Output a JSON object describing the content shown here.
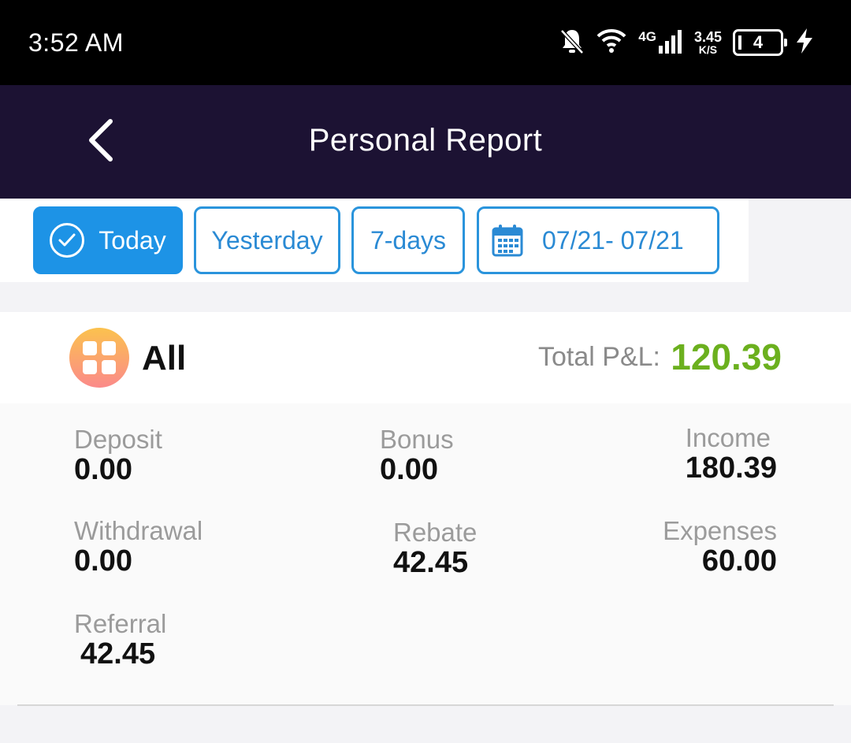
{
  "status_bar": {
    "time": "3:52 AM",
    "network_type": "4G",
    "speed_value": "3.45",
    "speed_unit": "K/S",
    "battery_level": "4",
    "icons": [
      "bell-off-icon",
      "wifi-icon",
      "signal-icon",
      "battery-icon",
      "charging-bolt-icon"
    ]
  },
  "header": {
    "title": "Personal Report",
    "back_icon": "chevron-left-icon",
    "background": "#1c1233"
  },
  "filters": {
    "items": [
      {
        "label": "Today",
        "active": true
      },
      {
        "label": "Yesterday",
        "active": false
      },
      {
        "label": "7-days",
        "active": false
      }
    ],
    "date_range": "07/21- 07/21",
    "accent_color": "#1d93e6"
  },
  "summary": {
    "category": "All",
    "total_pnl_label": "Total P&L:",
    "total_pnl_value": "120.39",
    "pnl_color": "#6bb01e"
  },
  "stats": {
    "deposit": {
      "label": "Deposit",
      "value": "0.00"
    },
    "bonus": {
      "label": "Bonus",
      "value": "0.00"
    },
    "income": {
      "label": "Income",
      "value": "180.39"
    },
    "withdrawal": {
      "label": "Withdrawal",
      "value": "0.00"
    },
    "rebate": {
      "label": "Rebate",
      "value": "42.45"
    },
    "expenses": {
      "label": "Expenses",
      "value": "60.00"
    },
    "referral": {
      "label": "Referral",
      "value": "42.45"
    }
  }
}
